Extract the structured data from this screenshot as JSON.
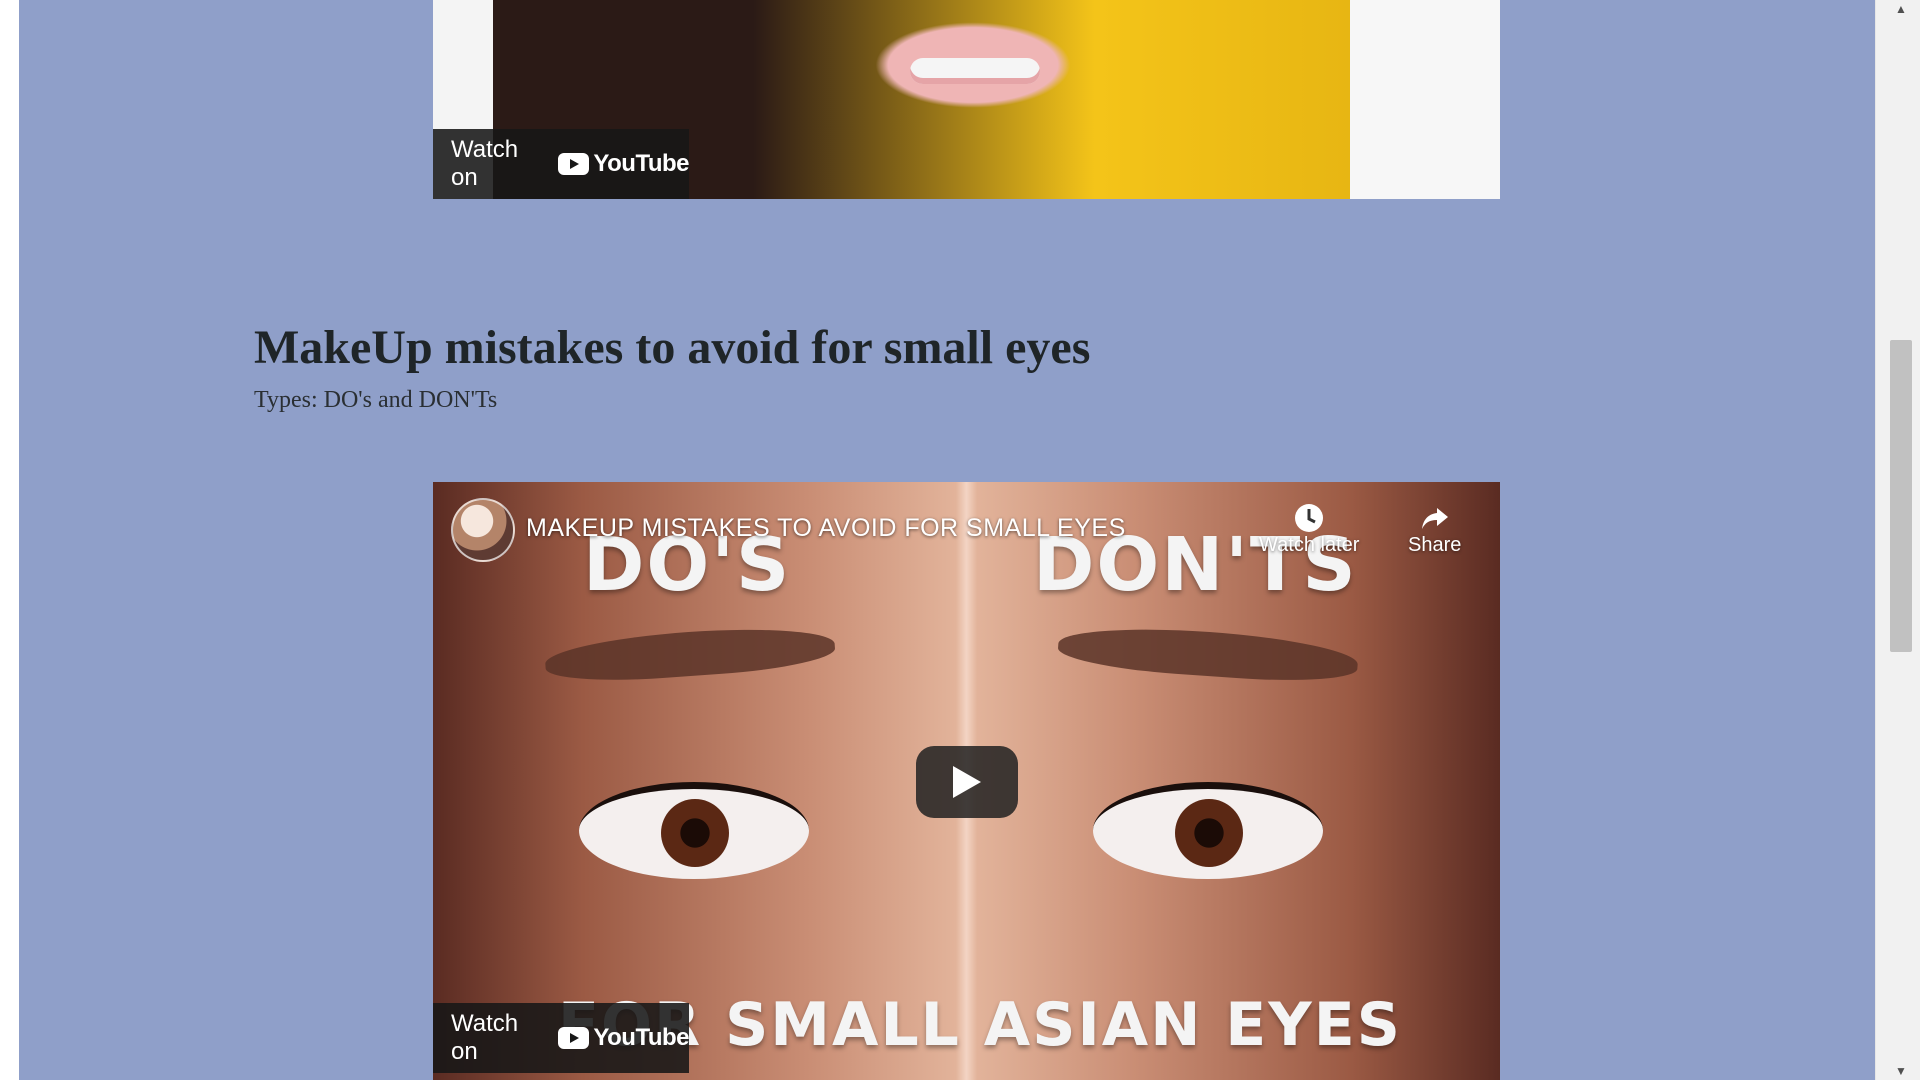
{
  "videos": {
    "top": {
      "watch_on": "Watch on",
      "youtube": "YouTube"
    },
    "bottom": {
      "title": "MAKEUP MISTAKES TO AVOID FOR SMALL EYES",
      "watch_later": "Watch later",
      "share": "Share",
      "watch_on": "Watch on",
      "youtube": "YouTube",
      "thumbnail_text": {
        "left": "DO'S",
        "right": "DON'TS",
        "bottom": "FOR SMALL ASIAN EYES"
      }
    }
  },
  "section": {
    "title": "MakeUp mistakes to avoid for small eyes",
    "subtitle": "Types: DO's and DON'Ts"
  }
}
